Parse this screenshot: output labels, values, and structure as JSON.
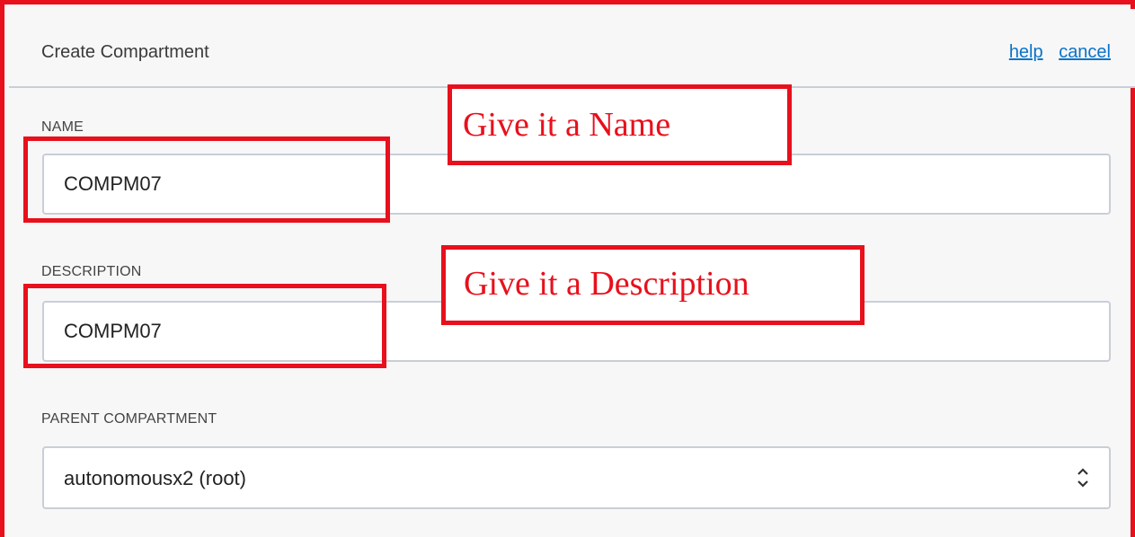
{
  "header": {
    "title": "Create Compartment",
    "help_label": "help",
    "cancel_label": "cancel"
  },
  "form": {
    "name": {
      "label": "NAME",
      "value": "COMPM07"
    },
    "description": {
      "label": "DESCRIPTION",
      "value": "COMPM07"
    },
    "parent": {
      "label": "PARENT COMPARTMENT",
      "selected": "autonomousx2 (root)"
    }
  },
  "annotations": {
    "name_callout": "Give it a Name",
    "description_callout": "Give it a Description",
    "color": "#e8101c"
  },
  "colors": {
    "link": "#0a72c8",
    "border": "#c9ced6",
    "panel_background": "#f7f7f8"
  },
  "icons": {
    "select_chevron": "chevron-up-down-icon"
  }
}
